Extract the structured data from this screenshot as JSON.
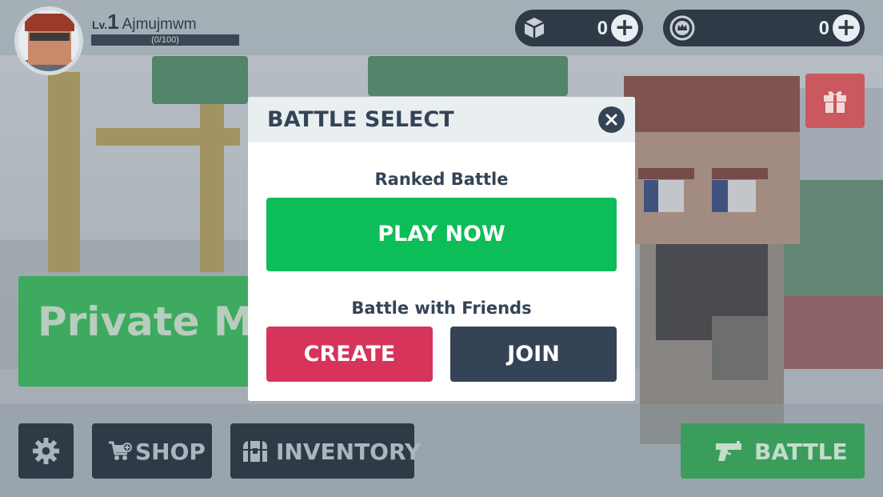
{
  "player": {
    "level_prefix": "Lv.",
    "level": "1",
    "name": "Ajmujmwm",
    "xp_text": "(0/100)",
    "xp_progress": 0
  },
  "currencies": [
    {
      "icon": "cube-icon",
      "value": "0",
      "plus": "+"
    },
    {
      "icon": "crown-coin-icon",
      "value": "0",
      "plus": "+"
    }
  ],
  "private_match": {
    "label": "Private MI"
  },
  "bottom": {
    "shop_label": "SHOP",
    "inventory_label": "INVENTORY",
    "battle_label": "BATTLE"
  },
  "modal": {
    "title": "BATTLE SELECT",
    "ranked_label": "Ranked Battle",
    "play_now": "PLAY NOW",
    "friends_label": "Battle with Friends",
    "create": "CREATE",
    "join": "JOIN"
  },
  "colors": {
    "play_green": "#0cbd58",
    "create_red": "#d6345b",
    "dark_navy": "#344456",
    "battle_green": "#3a9d5c",
    "gift_red": "#c9585f"
  }
}
